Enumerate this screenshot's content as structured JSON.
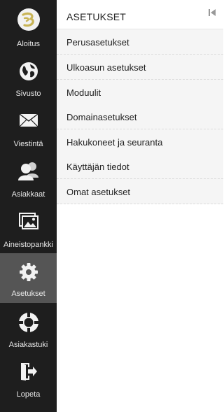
{
  "sidebar": {
    "items": [
      {
        "label": "Aloitus"
      },
      {
        "label": "Sivusto"
      },
      {
        "label": "Viestintä"
      },
      {
        "label": "Asiakkaat"
      },
      {
        "label": "Aineistopankki"
      },
      {
        "label": "Asetukset",
        "active": true
      },
      {
        "label": "Asiakastuki"
      },
      {
        "label": "Lopeta"
      }
    ]
  },
  "panel": {
    "title": "ASETUKSET",
    "items": [
      {
        "label": "Perusasetukset"
      },
      {
        "label": "Ulkoasun asetukset"
      },
      {
        "label": "Moduulit"
      },
      {
        "label": "Domainasetukset"
      },
      {
        "label": "Hakukoneet ja seuranta"
      },
      {
        "label": "Käyttäjän tiedot"
      },
      {
        "label": "Omat asetukset"
      }
    ]
  },
  "colors": {
    "sidebar_bg": "#1e1e1e",
    "sidebar_active_bg": "#555555",
    "menu_item_bg": "#f5f5f5",
    "logo_accent": "#c8b456"
  }
}
